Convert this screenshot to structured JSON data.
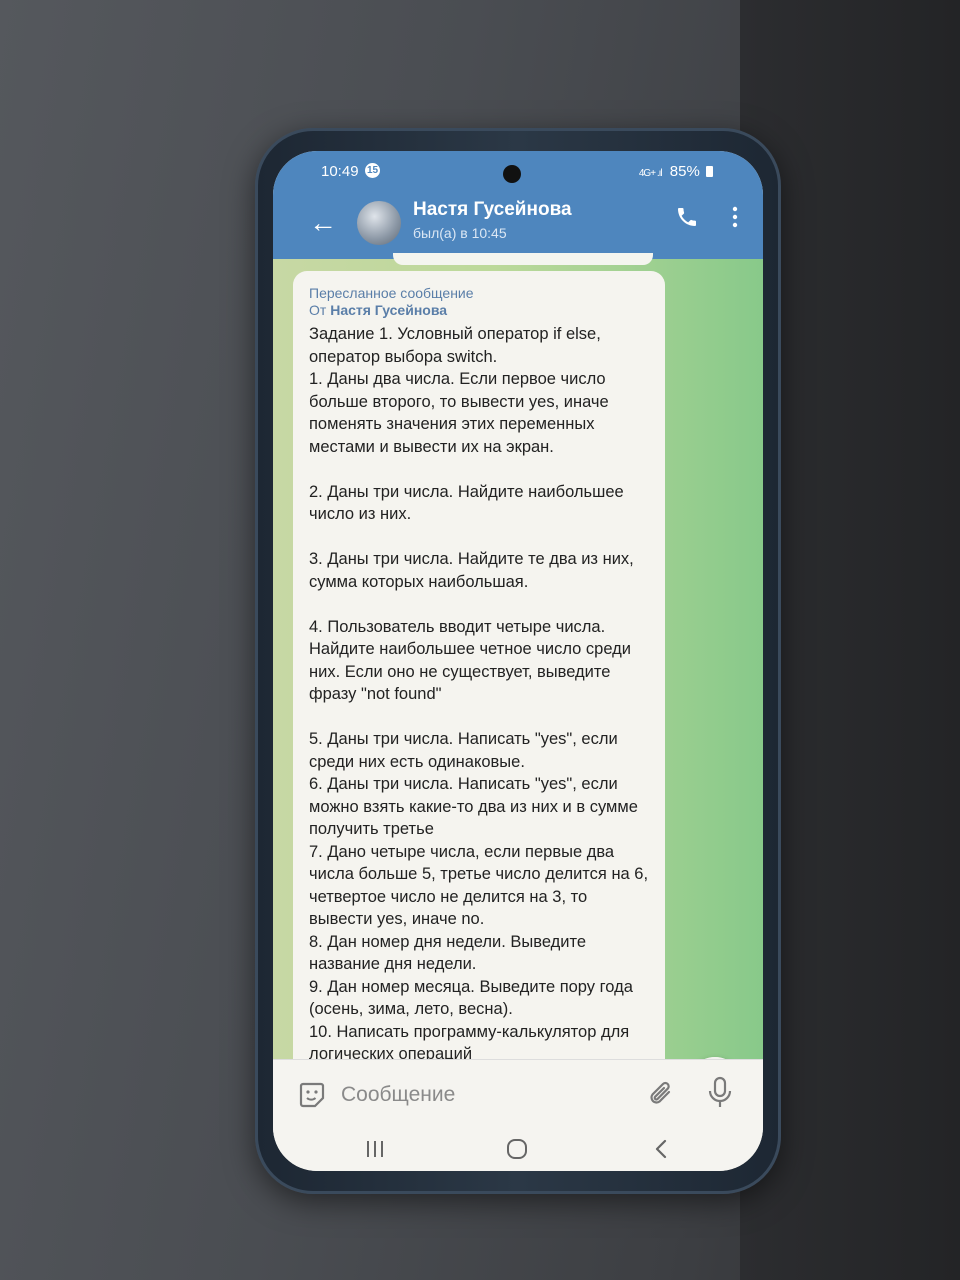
{
  "status_bar": {
    "time": "10:49",
    "notification_count": "15",
    "signal": "4G+ .ıl",
    "battery": "85%"
  },
  "header": {
    "back_icon": "arrow-left-icon",
    "contact_name": "Настя Гусейнова",
    "last_seen": "был(а) в 10:45",
    "call_icon": "phone-icon",
    "menu_icon": "kebab-menu-icon"
  },
  "message": {
    "forward_label": "Пересланное сообщение",
    "from_prefix": "От",
    "from_name": "Настя Гусейнова",
    "text": "Задание 1. Условный оператор if else, оператор выбора switch.\n1. Даны два числа. Если первое число больше второго, то вывести yes, иначе поменять значения этих переменных местами и вывести их на экран.\n\n2. Даны три числа. Найдите наибольшее число из них.\n\n3. Даны три числа. Найдите те два из них, сумма которых наибольшая.\n\n4. Пользователь вводит четыре числа. Найдите наибольшее четное число среди них. Если оно не существует, выведите фразу \"not found\"\n\n5. Даны три числа. Написать \"yes\", если среди них есть одинаковые.\n6. Даны три числа. Написать \"yes\", если можно взять какие-то два из них и в сумме получить третье\n7. Дано четыре числа, если первые два числа больше 5, третье число делится на 6, четвертое число не делится на 3, то вывести yes, иначе no.\n8. Дан номер дня недели. Выведите название дня недели.\n9. Дан номер месяца. Выведите пору года (осень, зима, лето, весна).\n10. Написать программу-калькулятор для логических операций"
  },
  "composer": {
    "placeholder": "Сообщение",
    "emoji_icon": "sticker-emoji-icon",
    "attach_icon": "paperclip-icon",
    "mic_icon": "microphone-icon"
  },
  "colors": {
    "header_bg": "#4e86be",
    "chat_wallpaper": "#a9d294",
    "bubble_bg": "#f5f4ef",
    "forward_text": "#5a7ea8"
  }
}
